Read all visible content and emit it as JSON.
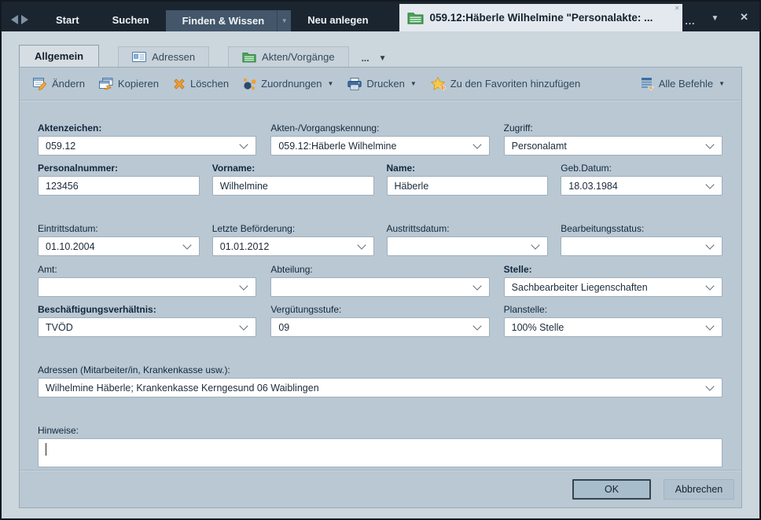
{
  "titlebar": {
    "nav": [
      {
        "label": "Start"
      },
      {
        "label": "Suchen"
      },
      {
        "label": "Finden & Wissen",
        "active": true,
        "has_dropdown": true
      },
      {
        "label": "Neu anlegen"
      }
    ],
    "document_tab": {
      "icon": "folder-icon",
      "title": "059.12:Häberle Wilhelmine \"Personalakte: ..."
    }
  },
  "glyphs": {
    "close": "✕",
    "dropdown_down": "▼",
    "overflow_dots": "..."
  },
  "tabstrip": {
    "tabs": [
      {
        "label": "Allgemein",
        "active": true
      },
      {
        "label": "Adressen",
        "icon": "address-card-icon"
      },
      {
        "label": "Akten/Vorgänge",
        "icon": "folder-icon"
      }
    ]
  },
  "toolbar": {
    "items": [
      {
        "label": "Ändern",
        "icon": "edit-icon"
      },
      {
        "label": "Kopieren",
        "icon": "copy-icon"
      },
      {
        "label": "Löschen",
        "icon": "delete-icon"
      },
      {
        "label": "Zuordnungen",
        "icon": "associations-icon",
        "dropdown": true
      },
      {
        "label": "Drucken",
        "icon": "print-icon",
        "dropdown": true
      },
      {
        "label": "Zu den Favoriten hinzufügen",
        "icon": "favorite-star-icon"
      }
    ],
    "right": {
      "label": "Alle Befehle",
      "icon": "command-list-icon",
      "dropdown": true
    }
  },
  "form": {
    "aktenzeichen": {
      "label": "Aktenzeichen:",
      "value": "059.12",
      "required": true
    },
    "kennung": {
      "label": "Akten-/Vorgangskennung:",
      "value": "059.12:Häberle Wilhelmine"
    },
    "zugriff": {
      "label": "Zugriff:",
      "value": "Personalamt"
    },
    "personalnummer": {
      "label": "Personalnummer:",
      "value": "123456",
      "required": true
    },
    "vorname": {
      "label": "Vorname:",
      "value": "Wilhelmine",
      "required": true
    },
    "name": {
      "label": "Name:",
      "value": "Häberle",
      "required": true
    },
    "gebdatum": {
      "label": "Geb.Datum:",
      "value": "18.03.1984"
    },
    "eintrittsdatum": {
      "label": "Eintrittsdatum:",
      "value": "01.10.2004"
    },
    "befoerderung": {
      "label": "Letzte Beförderung:",
      "value": "01.01.2012"
    },
    "austrittsdatum": {
      "label": "Austrittsdatum:",
      "value": ""
    },
    "bearbeitungsstatus": {
      "label": "Bearbeitungsstatus:",
      "value": ""
    },
    "amt": {
      "label": "Amt:",
      "value": ""
    },
    "abteilung": {
      "label": "Abteilung:",
      "value": ""
    },
    "stelle": {
      "label": "Stelle:",
      "value": "Sachbearbeiter Liegenschaften",
      "required": true
    },
    "beschaeftigung": {
      "label": "Beschäftigungsverhältnis:",
      "value": "TVÖD",
      "required": true
    },
    "verguetungsstufe": {
      "label": "Vergütungsstufe:",
      "value": "09"
    },
    "planstelle": {
      "label": "Planstelle:",
      "value": "100% Stelle"
    },
    "adressen": {
      "label": "Adressen (Mitarbeiter/in, Krankenkasse usw.):",
      "value": "Wilhelmine Häberle; Krankenkasse Kerngesund 06 Waiblingen"
    },
    "hinweise": {
      "label": "Hinweise:",
      "value": ""
    }
  },
  "footer": {
    "ok": "OK",
    "cancel": "Abbrechen"
  },
  "colors": {
    "titlebar_bg": "#1b2530",
    "nav_active_bg": "#43566a",
    "window_bg": "#ccd6dd",
    "panel_bg": "#b9c8d3",
    "accent_orange": "#f0a132",
    "folder_green": "#48a357",
    "printer_blue": "#3a6ea5",
    "label_text": "#13273c"
  }
}
